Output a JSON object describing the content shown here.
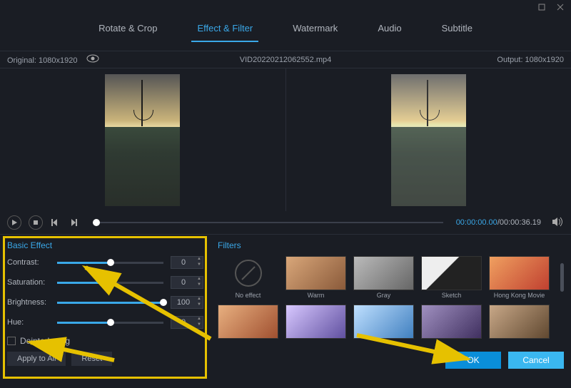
{
  "window": {
    "maximize_title": "Maximize",
    "close_title": "Close"
  },
  "tabs": {
    "rotate_crop": "Rotate & Crop",
    "effect_filter": "Effect & Filter",
    "watermark": "Watermark",
    "audio": "Audio",
    "subtitle": "Subtitle"
  },
  "info": {
    "original": "Original: 1080x1920",
    "filename": "VID20220212062552.mp4",
    "output": "Output: 1080x1920"
  },
  "playback": {
    "current": "00:00:00.00",
    "duration": "00:00:36.19"
  },
  "basic_effect": {
    "title": "Basic Effect",
    "contrast_label": "Contrast:",
    "contrast_value": "0",
    "contrast_pct": 50,
    "saturation_label": "Saturation:",
    "saturation_value": "0",
    "saturation_pct": 50,
    "brightness_label": "Brightness:",
    "brightness_value": "100",
    "brightness_pct": 100,
    "hue_label": "Hue:",
    "hue_value": "0",
    "hue_pct": 50,
    "deinterlacing": "Deinterlacing",
    "apply_all": "Apply to All",
    "reset": "Reset"
  },
  "filters": {
    "title": "Filters",
    "no_effect": "No effect",
    "warm": "Warm",
    "gray": "Gray",
    "sketch": "Sketch",
    "hk": "Hong Kong Movie"
  },
  "footer": {
    "ok": "OK",
    "cancel": "Cancel"
  }
}
